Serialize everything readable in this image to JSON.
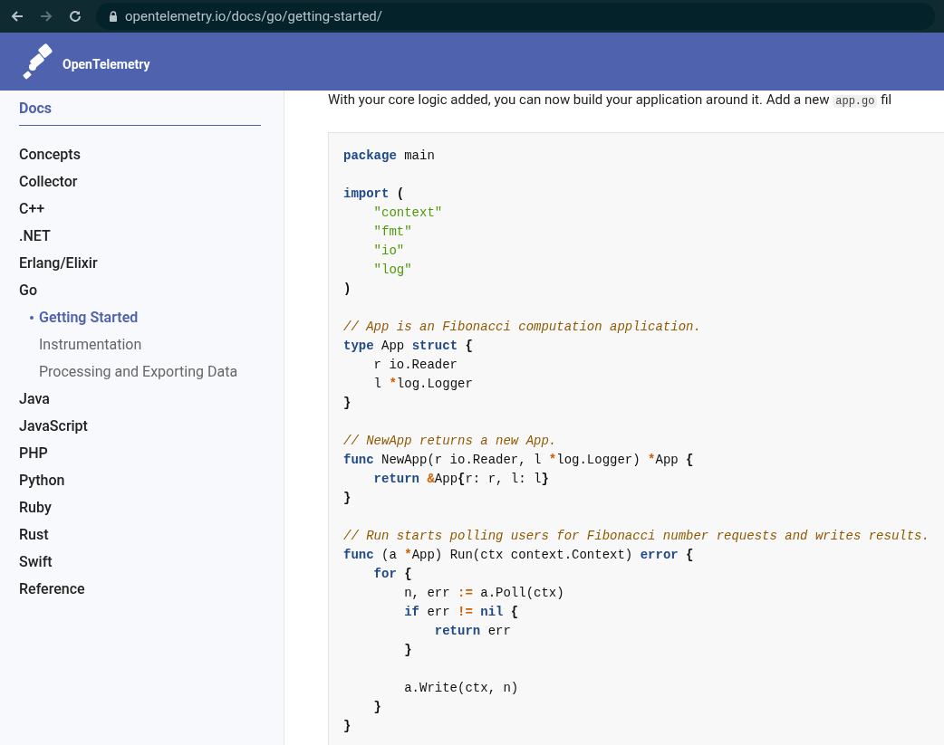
{
  "browser": {
    "url": "opentelemetry.io/docs/go/getting-started/"
  },
  "header": {
    "logo_text": "OpenTelemetry"
  },
  "sidebar": {
    "title": "Docs",
    "items": [
      {
        "label": "Concepts",
        "selected": false
      },
      {
        "label": "Collector",
        "selected": false
      },
      {
        "label": "C++",
        "selected": false
      },
      {
        "label": ".NET",
        "selected": false
      },
      {
        "label": "Erlang/Elixir",
        "selected": false
      },
      {
        "label": "Go",
        "selected": false,
        "children": [
          {
            "label": "Getting Started",
            "selected": true
          },
          {
            "label": "Instrumentation",
            "selected": false
          },
          {
            "label": "Processing and Exporting Data",
            "selected": false
          }
        ]
      },
      {
        "label": "Java",
        "selected": false
      },
      {
        "label": "JavaScript",
        "selected": false
      },
      {
        "label": "PHP",
        "selected": false
      },
      {
        "label": "Python",
        "selected": false
      },
      {
        "label": "Ruby",
        "selected": false
      },
      {
        "label": "Rust",
        "selected": false
      },
      {
        "label": "Swift",
        "selected": false
      },
      {
        "label": "Reference",
        "selected": false
      }
    ]
  },
  "content": {
    "intro": {
      "text": "With your core logic added, you can now build your application around it. Add a new ",
      "code": "app.go",
      "after": " fil"
    },
    "code_paragraphs": [
      [
        [
          {
            "kind": "kw",
            "text": "package"
          },
          {
            "kind": "plain",
            "text": " main"
          }
        ]
      ],
      [
        [
          {
            "kind": "kw",
            "text": "import"
          },
          {
            "kind": "punct",
            "text": " ("
          }
        ],
        [
          {
            "kind": "str",
            "text": "    \"context\""
          }
        ],
        [
          {
            "kind": "str",
            "text": "    \"fmt\""
          }
        ],
        [
          {
            "kind": "str",
            "text": "    \"io\""
          }
        ],
        [
          {
            "kind": "str",
            "text": "    \"log\""
          }
        ],
        [
          {
            "kind": "punct",
            "text": ")"
          }
        ]
      ],
      [
        [
          {
            "kind": "com",
            "text": "// App is an Fibonacci computation application."
          }
        ],
        [
          {
            "kind": "kw",
            "text": "type"
          },
          {
            "kind": "plain",
            "text": " App "
          },
          {
            "kind": "kw",
            "text": "struct"
          },
          {
            "kind": "punct",
            "text": " {"
          }
        ],
        [
          {
            "kind": "plain",
            "text": "    r io.Reader"
          }
        ],
        [
          {
            "kind": "plain",
            "text": "    l "
          },
          {
            "kind": "op",
            "text": "*"
          },
          {
            "kind": "plain",
            "text": "log.Logger"
          }
        ],
        [
          {
            "kind": "punct",
            "text": "}"
          }
        ]
      ],
      [
        [
          {
            "kind": "com",
            "text": "// NewApp returns a new App."
          }
        ],
        [
          {
            "kind": "kw",
            "text": "func"
          },
          {
            "kind": "plain",
            "text": " NewApp(r io.Reader, l "
          },
          {
            "kind": "op",
            "text": "*"
          },
          {
            "kind": "plain",
            "text": "log.Logger) "
          },
          {
            "kind": "op",
            "text": "*"
          },
          {
            "kind": "plain",
            "text": "App "
          },
          {
            "kind": "punct",
            "text": "{"
          }
        ],
        [
          {
            "kind": "kw",
            "text": "    return"
          },
          {
            "kind": "op",
            "text": " &"
          },
          {
            "kind": "plain",
            "text": "App"
          },
          {
            "kind": "punct",
            "text": "{"
          },
          {
            "kind": "plain",
            "text": "r: r, l: l"
          },
          {
            "kind": "punct",
            "text": "}"
          }
        ],
        [
          {
            "kind": "punct",
            "text": "}"
          }
        ]
      ],
      [
        [
          {
            "kind": "com",
            "text": "// Run starts polling users for Fibonacci number requests and writes results."
          }
        ],
        [
          {
            "kind": "kw",
            "text": "func"
          },
          {
            "kind": "plain",
            "text": " (a "
          },
          {
            "kind": "op",
            "text": "*"
          },
          {
            "kind": "plain",
            "text": "App) Run(ctx context.Context) "
          },
          {
            "kind": "kw",
            "text": "error"
          },
          {
            "kind": "punct",
            "text": " {"
          }
        ],
        [
          {
            "kind": "kw",
            "text": "    for"
          },
          {
            "kind": "punct",
            "text": " {"
          }
        ],
        [
          {
            "kind": "plain",
            "text": "        n, err "
          },
          {
            "kind": "op",
            "text": ":="
          },
          {
            "kind": "plain",
            "text": " a.Poll(ctx)"
          }
        ],
        [
          {
            "kind": "kw",
            "text": "        if"
          },
          {
            "kind": "plain",
            "text": " err "
          },
          {
            "kind": "op",
            "text": "!="
          },
          {
            "kind": "kw",
            "text": " nil"
          },
          {
            "kind": "punct",
            "text": " {"
          }
        ],
        [
          {
            "kind": "kw",
            "text": "            return"
          },
          {
            "kind": "plain",
            "text": " err"
          }
        ],
        [
          {
            "kind": "punct",
            "text": "        }"
          }
        ]
      ],
      [
        [
          {
            "kind": "plain",
            "text": "        a.Write(ctx, n)"
          }
        ],
        [
          {
            "kind": "punct",
            "text": "    }"
          }
        ],
        [
          {
            "kind": "punct",
            "text": "}"
          }
        ]
      ]
    ]
  }
}
